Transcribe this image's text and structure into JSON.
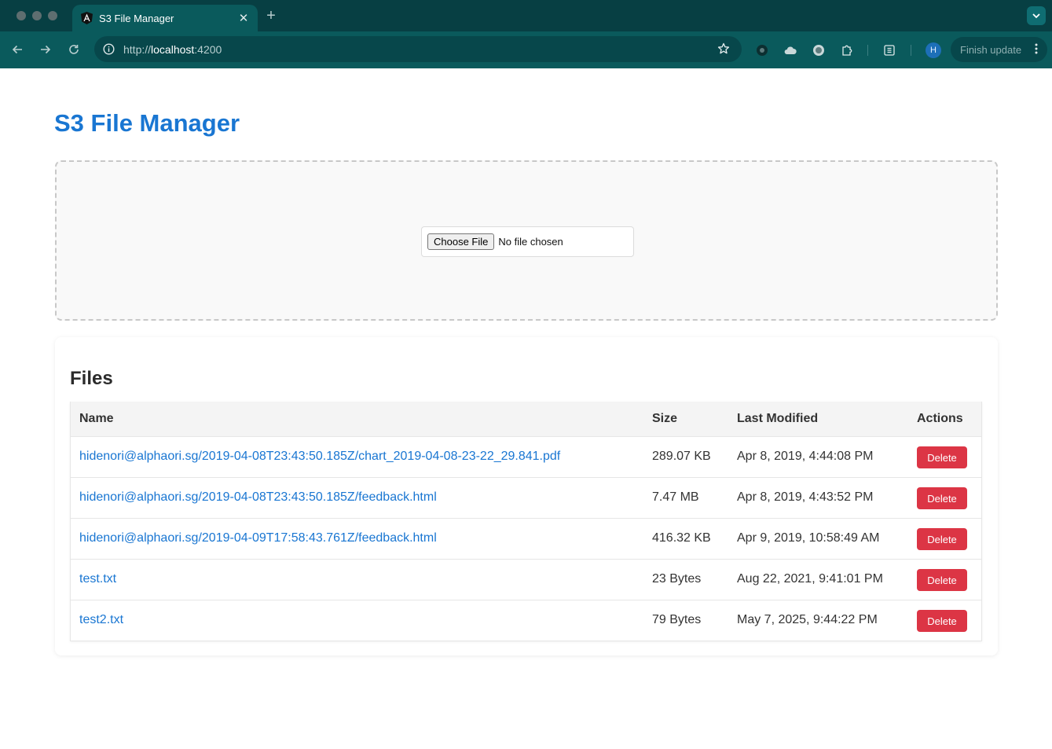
{
  "browser": {
    "tab_title": "S3 File Manager",
    "url_prefix": "http://",
    "url_host": "localhost",
    "url_port": ":4200",
    "avatar_initial": "H",
    "finish_update_label": "Finish update",
    "new_tab_symbol": "+",
    "close_tab_symbol": "✕"
  },
  "page": {
    "title": "S3 File Manager",
    "upload": {
      "choose_label": "Choose File",
      "status": "No file chosen"
    },
    "files_heading": "Files",
    "columns": {
      "name": "Name",
      "size": "Size",
      "modified": "Last Modified",
      "actions": "Actions"
    },
    "delete_label": "Delete",
    "rows": [
      {
        "name": "hidenori@alphaori.sg/2019-04-08T23:43:50.185Z/chart_2019-04-08-23-22_29.841.pdf",
        "size": "289.07 KB",
        "modified": "Apr 8, 2019, 4:44:08 PM"
      },
      {
        "name": "hidenori@alphaori.sg/2019-04-08T23:43:50.185Z/feedback.html",
        "size": "7.47 MB",
        "modified": "Apr 8, 2019, 4:43:52 PM"
      },
      {
        "name": "hidenori@alphaori.sg/2019-04-09T17:58:43.761Z/feedback.html",
        "size": "416.32 KB",
        "modified": "Apr 9, 2019, 10:58:49 AM"
      },
      {
        "name": "test.txt",
        "size": "23 Bytes",
        "modified": "Aug 22, 2021, 9:41:01 PM"
      },
      {
        "name": "test2.txt",
        "size": "79 Bytes",
        "modified": "May 7, 2025, 9:44:22 PM"
      }
    ]
  },
  "colors": {
    "chrome_bg": "#0a5a5c",
    "tabstrip_bg": "#073f43",
    "title_blue": "#1976d2",
    "delete_red": "#dc3545"
  },
  "icons": {
    "favicon": "angular-logo-icon",
    "back": "arrow-left-icon",
    "forward": "arrow-right-icon",
    "reload": "reload-icon",
    "info": "info-icon",
    "star": "star-icon",
    "extensions": [
      "record-icon",
      "cloud-icon",
      "globe-icon",
      "puzzle-icon",
      "reading-list-icon"
    ],
    "menu": "kebab-menu-icon"
  }
}
